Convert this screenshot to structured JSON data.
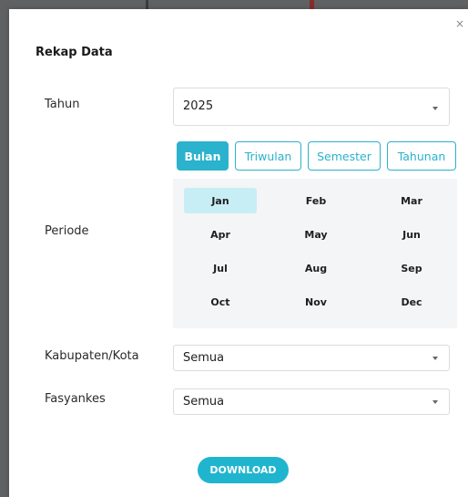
{
  "modal": {
    "title": "Rekap Data",
    "close_glyph": "×"
  },
  "form": {
    "tahun": {
      "label": "Tahun",
      "value": "2025"
    },
    "periode": {
      "label": "Periode",
      "tabs": [
        {
          "label": "Bulan",
          "active": true
        },
        {
          "label": "Triwulan",
          "active": false
        },
        {
          "label": "Semester",
          "active": false
        },
        {
          "label": "Tahunan",
          "active": false
        }
      ],
      "months": [
        "Jan",
        "Feb",
        "Mar",
        "Apr",
        "May",
        "Jun",
        "Jul",
        "Aug",
        "Sep",
        "Oct",
        "Nov",
        "Dec"
      ],
      "selected_month": "Jan"
    },
    "kabupaten": {
      "label": "Kabupaten/Kota",
      "value": "Semua"
    },
    "fasyankes": {
      "label": "Fasyankes",
      "value": "Semua"
    }
  },
  "actions": {
    "download_label": "DOWNLOAD"
  },
  "colors": {
    "accent": "#2bb2cc",
    "button": "#20b5cf",
    "selected_month_bg": "#c8eef5",
    "panel_bg": "#f4f5f7"
  },
  "icons": {
    "close": "close-icon",
    "dropdown": "chevron-down-icon"
  }
}
